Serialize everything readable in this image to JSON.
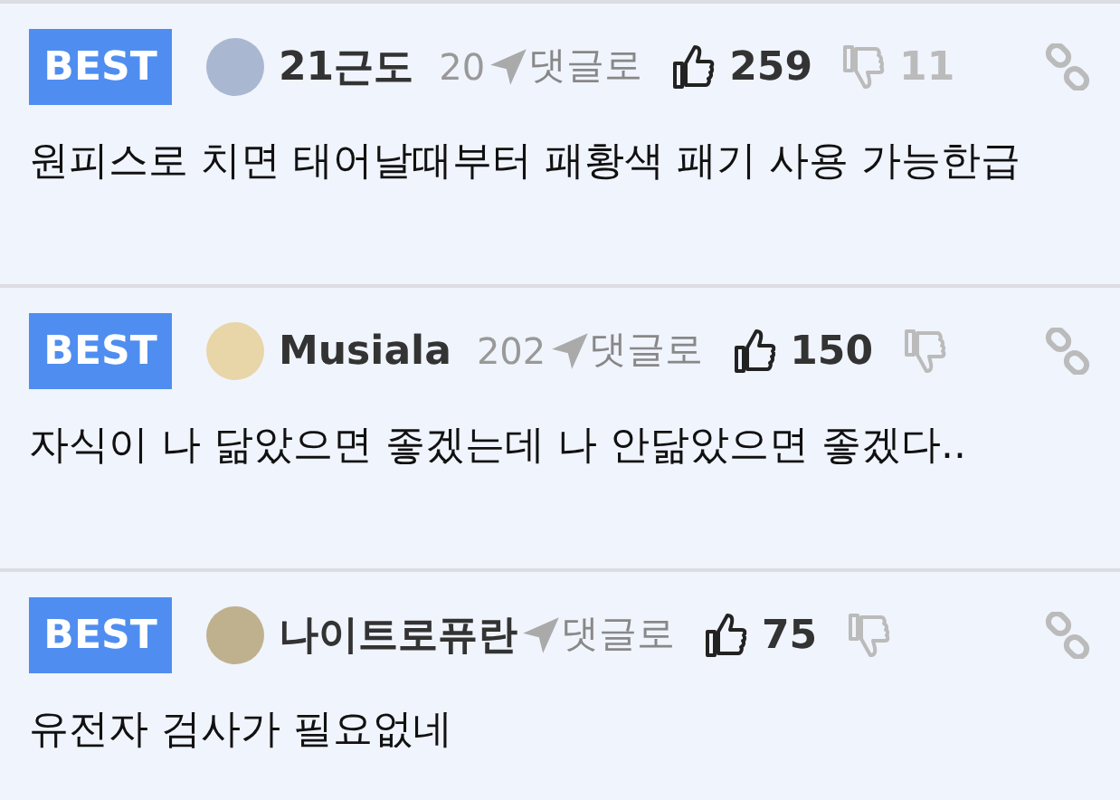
{
  "comments": [
    {
      "badge": "BEST",
      "author": "21근도",
      "date": "20",
      "reply_label": "댓글로",
      "likes": "259",
      "dislikes": "11",
      "text": "원피스로 치면 태어날때부터 패황색 패기 사용 가능한급"
    },
    {
      "badge": "BEST",
      "author": "Musiala",
      "date": "202",
      "reply_label": "댓글로",
      "likes": "150",
      "text": "자식이 나 닮았으면 좋겠는데 나 안닮았으면 좋겠다.."
    },
    {
      "badge": "BEST",
      "author": "나이트로퓨란",
      "reply_label": "댓글로",
      "likes": "75",
      "text": "유전자 검사가 필요없네"
    }
  ]
}
